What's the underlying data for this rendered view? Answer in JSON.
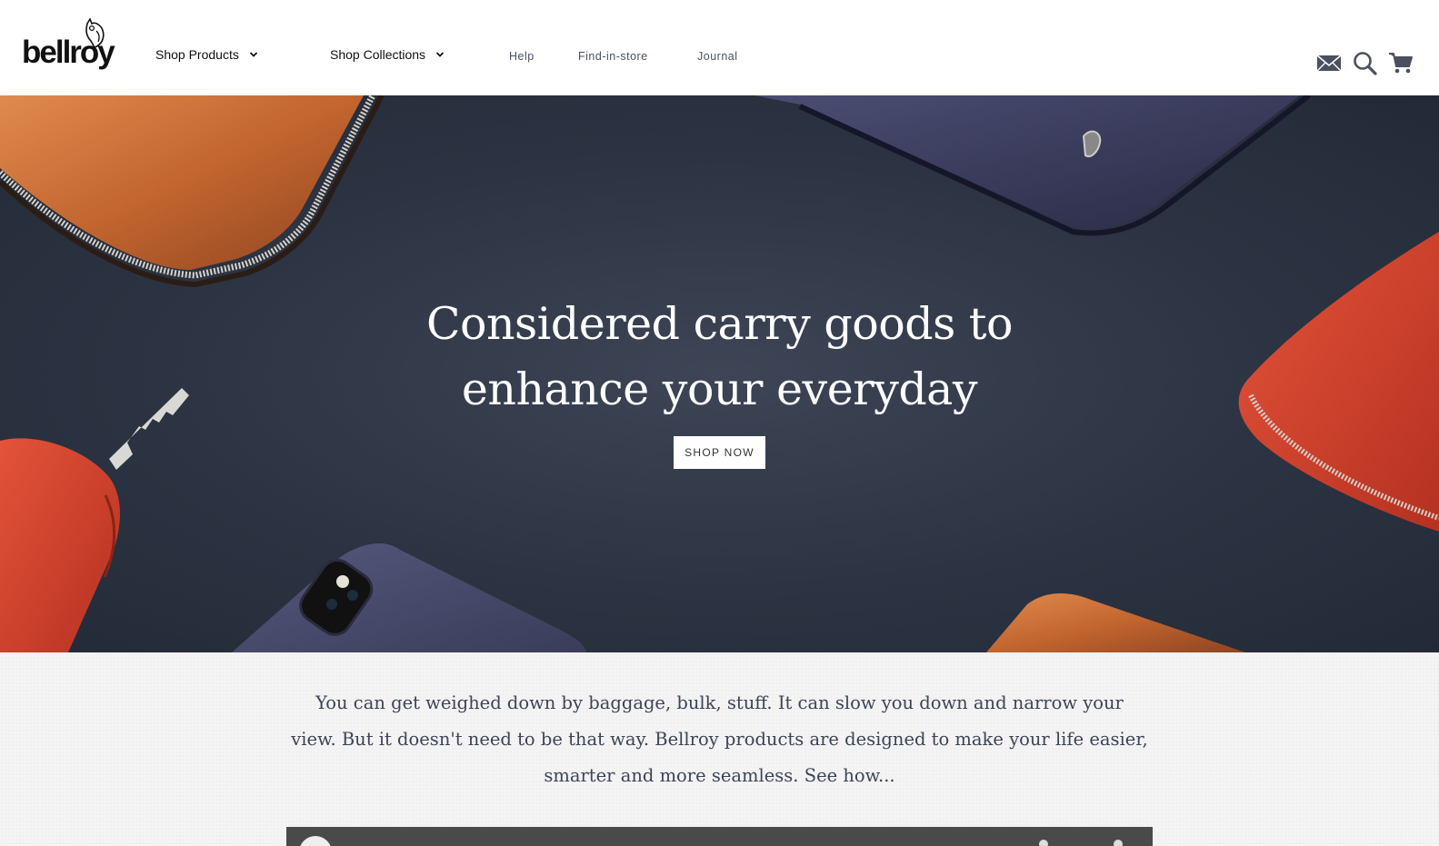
{
  "brand": {
    "logo_text": "bellroy"
  },
  "nav": {
    "shop_products": "Shop Products",
    "shop_collections": "Shop Collections",
    "help": "Help",
    "find_in_store": "Find-in-store",
    "journal": "Journal"
  },
  "header_icons": [
    "mail-icon",
    "search-icon",
    "cart-icon"
  ],
  "hero": {
    "title_line1": "Considered carry goods to",
    "title_line2": "enhance your everyday",
    "cta": "SHOP NOW"
  },
  "intro": {
    "text": "You can get weighed down by baggage, bulk, stuff. It can slow you down and narrow your view. But it doesn't need to be that way. Bellroy products are designed to make your life easier, smarter and more seamless. See how..."
  },
  "colors": {
    "hero_bg": "#2c3342",
    "tan_leather": "#c2652f",
    "red_leather": "#d9412a",
    "navy_leather": "#3a3b5c",
    "intro_text": "#3c4456"
  }
}
